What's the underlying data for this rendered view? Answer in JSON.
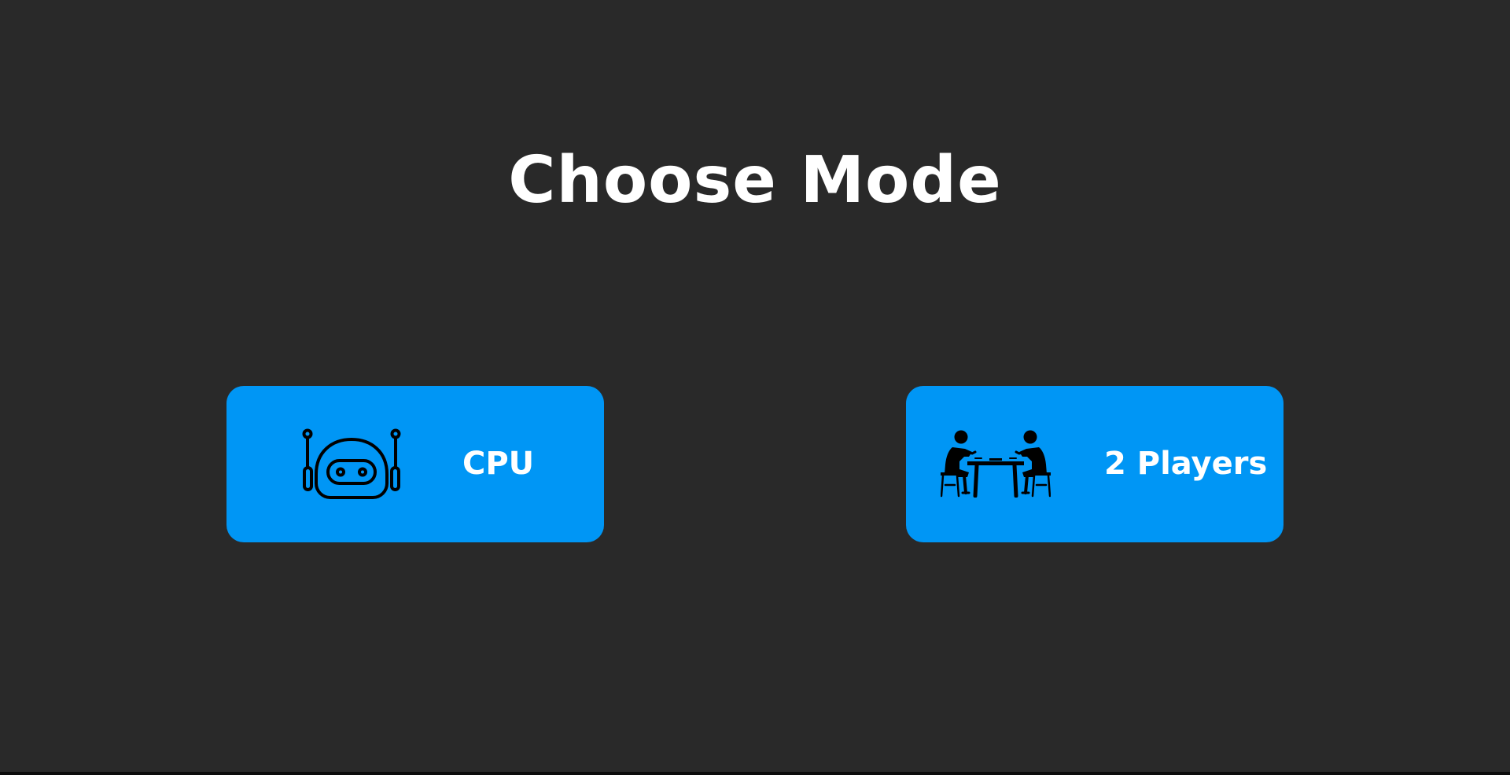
{
  "screen": {
    "title": "Choose Mode",
    "background_color": "#292929"
  },
  "modes": [
    {
      "label": "CPU",
      "icon": "robot-icon",
      "button_color": "#0096F5"
    },
    {
      "label": "2 Players",
      "icon": "two-players-table-icon",
      "button_color": "#0096F5"
    }
  ]
}
